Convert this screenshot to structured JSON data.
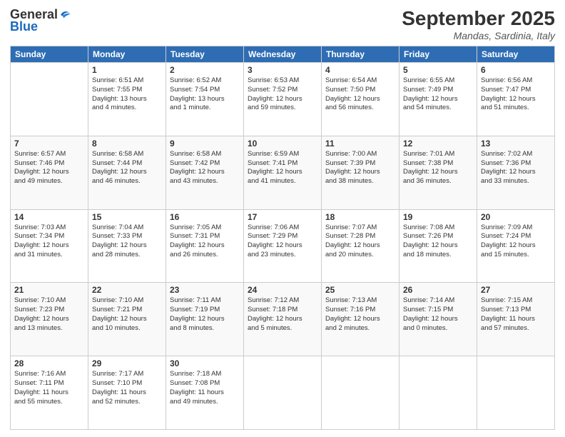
{
  "logo": {
    "general": "General",
    "blue": "Blue"
  },
  "header": {
    "month": "September 2025",
    "location": "Mandas, Sardinia, Italy"
  },
  "columns": [
    "Sunday",
    "Monday",
    "Tuesday",
    "Wednesday",
    "Thursday",
    "Friday",
    "Saturday"
  ],
  "weeks": [
    [
      {
        "day": "",
        "info": ""
      },
      {
        "day": "1",
        "info": "Sunrise: 6:51 AM\nSunset: 7:55 PM\nDaylight: 13 hours\nand 4 minutes."
      },
      {
        "day": "2",
        "info": "Sunrise: 6:52 AM\nSunset: 7:54 PM\nDaylight: 13 hours\nand 1 minute."
      },
      {
        "day": "3",
        "info": "Sunrise: 6:53 AM\nSunset: 7:52 PM\nDaylight: 12 hours\nand 59 minutes."
      },
      {
        "day": "4",
        "info": "Sunrise: 6:54 AM\nSunset: 7:50 PM\nDaylight: 12 hours\nand 56 minutes."
      },
      {
        "day": "5",
        "info": "Sunrise: 6:55 AM\nSunset: 7:49 PM\nDaylight: 12 hours\nand 54 minutes."
      },
      {
        "day": "6",
        "info": "Sunrise: 6:56 AM\nSunset: 7:47 PM\nDaylight: 12 hours\nand 51 minutes."
      }
    ],
    [
      {
        "day": "7",
        "info": "Sunrise: 6:57 AM\nSunset: 7:46 PM\nDaylight: 12 hours\nand 49 minutes."
      },
      {
        "day": "8",
        "info": "Sunrise: 6:58 AM\nSunset: 7:44 PM\nDaylight: 12 hours\nand 46 minutes."
      },
      {
        "day": "9",
        "info": "Sunrise: 6:58 AM\nSunset: 7:42 PM\nDaylight: 12 hours\nand 43 minutes."
      },
      {
        "day": "10",
        "info": "Sunrise: 6:59 AM\nSunset: 7:41 PM\nDaylight: 12 hours\nand 41 minutes."
      },
      {
        "day": "11",
        "info": "Sunrise: 7:00 AM\nSunset: 7:39 PM\nDaylight: 12 hours\nand 38 minutes."
      },
      {
        "day": "12",
        "info": "Sunrise: 7:01 AM\nSunset: 7:38 PM\nDaylight: 12 hours\nand 36 minutes."
      },
      {
        "day": "13",
        "info": "Sunrise: 7:02 AM\nSunset: 7:36 PM\nDaylight: 12 hours\nand 33 minutes."
      }
    ],
    [
      {
        "day": "14",
        "info": "Sunrise: 7:03 AM\nSunset: 7:34 PM\nDaylight: 12 hours\nand 31 minutes."
      },
      {
        "day": "15",
        "info": "Sunrise: 7:04 AM\nSunset: 7:33 PM\nDaylight: 12 hours\nand 28 minutes."
      },
      {
        "day": "16",
        "info": "Sunrise: 7:05 AM\nSunset: 7:31 PM\nDaylight: 12 hours\nand 26 minutes."
      },
      {
        "day": "17",
        "info": "Sunrise: 7:06 AM\nSunset: 7:29 PM\nDaylight: 12 hours\nand 23 minutes."
      },
      {
        "day": "18",
        "info": "Sunrise: 7:07 AM\nSunset: 7:28 PM\nDaylight: 12 hours\nand 20 minutes."
      },
      {
        "day": "19",
        "info": "Sunrise: 7:08 AM\nSunset: 7:26 PM\nDaylight: 12 hours\nand 18 minutes."
      },
      {
        "day": "20",
        "info": "Sunrise: 7:09 AM\nSunset: 7:24 PM\nDaylight: 12 hours\nand 15 minutes."
      }
    ],
    [
      {
        "day": "21",
        "info": "Sunrise: 7:10 AM\nSunset: 7:23 PM\nDaylight: 12 hours\nand 13 minutes."
      },
      {
        "day": "22",
        "info": "Sunrise: 7:10 AM\nSunset: 7:21 PM\nDaylight: 12 hours\nand 10 minutes."
      },
      {
        "day": "23",
        "info": "Sunrise: 7:11 AM\nSunset: 7:19 PM\nDaylight: 12 hours\nand 8 minutes."
      },
      {
        "day": "24",
        "info": "Sunrise: 7:12 AM\nSunset: 7:18 PM\nDaylight: 12 hours\nand 5 minutes."
      },
      {
        "day": "25",
        "info": "Sunrise: 7:13 AM\nSunset: 7:16 PM\nDaylight: 12 hours\nand 2 minutes."
      },
      {
        "day": "26",
        "info": "Sunrise: 7:14 AM\nSunset: 7:15 PM\nDaylight: 12 hours\nand 0 minutes."
      },
      {
        "day": "27",
        "info": "Sunrise: 7:15 AM\nSunset: 7:13 PM\nDaylight: 11 hours\nand 57 minutes."
      }
    ],
    [
      {
        "day": "28",
        "info": "Sunrise: 7:16 AM\nSunset: 7:11 PM\nDaylight: 11 hours\nand 55 minutes."
      },
      {
        "day": "29",
        "info": "Sunrise: 7:17 AM\nSunset: 7:10 PM\nDaylight: 11 hours\nand 52 minutes."
      },
      {
        "day": "30",
        "info": "Sunrise: 7:18 AM\nSunset: 7:08 PM\nDaylight: 11 hours\nand 49 minutes."
      },
      {
        "day": "",
        "info": ""
      },
      {
        "day": "",
        "info": ""
      },
      {
        "day": "",
        "info": ""
      },
      {
        "day": "",
        "info": ""
      }
    ]
  ]
}
